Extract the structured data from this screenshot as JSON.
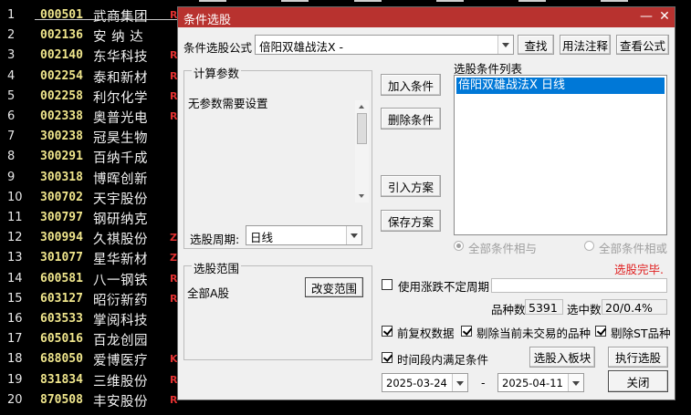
{
  "stocks": [
    {
      "idx": "1",
      "code": "000501",
      "name": "武商集团",
      "flag": "R"
    },
    {
      "idx": "2",
      "code": "002136",
      "name": "安 纳 达",
      "flag": ""
    },
    {
      "idx": "3",
      "code": "002140",
      "name": "东华科技",
      "flag": "R"
    },
    {
      "idx": "4",
      "code": "002254",
      "name": "泰和新材",
      "flag": "R"
    },
    {
      "idx": "5",
      "code": "002258",
      "name": "利尔化学",
      "flag": "R"
    },
    {
      "idx": "6",
      "code": "002338",
      "name": "奥普光电",
      "flag": "R"
    },
    {
      "idx": "7",
      "code": "300238",
      "name": "冠昊生物",
      "flag": ""
    },
    {
      "idx": "8",
      "code": "300291",
      "name": "百纳千成",
      "flag": ""
    },
    {
      "idx": "9",
      "code": "300318",
      "name": "博晖创新",
      "flag": ""
    },
    {
      "idx": "10",
      "code": "300702",
      "name": "天宇股份",
      "flag": ""
    },
    {
      "idx": "11",
      "code": "300797",
      "name": "钢研纳克",
      "flag": ""
    },
    {
      "idx": "12",
      "code": "300994",
      "name": "久祺股份",
      "flag": "Z"
    },
    {
      "idx": "13",
      "code": "301077",
      "name": "星华新材",
      "flag": "Z"
    },
    {
      "idx": "14",
      "code": "600581",
      "name": "八一钢铁",
      "flag": "R"
    },
    {
      "idx": "15",
      "code": "603127",
      "name": "昭衍新药",
      "flag": "R"
    },
    {
      "idx": "16",
      "code": "603533",
      "name": "掌阅科技",
      "flag": ""
    },
    {
      "idx": "17",
      "code": "605016",
      "name": "百龙创园",
      "flag": ""
    },
    {
      "idx": "18",
      "code": "688050",
      "name": "爱博医疗",
      "flag": "K"
    },
    {
      "idx": "19",
      "code": "831834",
      "name": "三维股份",
      "flag": "R"
    },
    {
      "idx": "20",
      "code": "870508",
      "name": "丰安股份",
      "flag": "R"
    }
  ],
  "dialog": {
    "title": "条件选股",
    "minimize_glyph": "—",
    "close_glyph": "✕",
    "formula_label": "条件选股公式",
    "formula_value": "倍阳双雄战法X -",
    "find_btn": "查找",
    "usage_btn": "用法注释",
    "view_btn": "查看公式",
    "params_group": "计算参数",
    "params_text": "无参数需要设置",
    "period_label": "选股周期:",
    "period_value": "日线",
    "add_cond_btn": "加入条件",
    "del_cond_btn": "删除条件",
    "import_btn": "引入方案",
    "save_btn": "保存方案",
    "cond_list_label": "选股条件列表",
    "cond_items": [
      "倍阳双雄战法X  日线"
    ],
    "radio_and": "全部条件相与",
    "radio_or": "全部条件相或",
    "status": "选股完毕.",
    "range_group": "选股范围",
    "range_value": "全部A股",
    "change_range_btn": "改变范围",
    "use_limit_label": "使用涨跌不定周期",
    "stock_count_label": "品种数",
    "stock_count": "5391",
    "selected_label": "选中数",
    "selected_value": "20/0.4%",
    "pre_adjust_label": "前复权数据",
    "exclude_untraded_label": "剔除当前未交易的品种",
    "exclude_st_label": "剔除ST品种",
    "time_cond_label": "时间段内满足条件",
    "add_to_board_btn": "选股入板块",
    "run_btn": "执行选股",
    "date_from": "2025-03-24",
    "date_sep": "-",
    "date_to": "2025-04-11",
    "close_btn": "关闭"
  },
  "colors": {
    "titlebar": "#b8322f",
    "code": "#f0e68c",
    "flag": "#e03030",
    "status": "#e02020",
    "selection": "#0078d7"
  }
}
